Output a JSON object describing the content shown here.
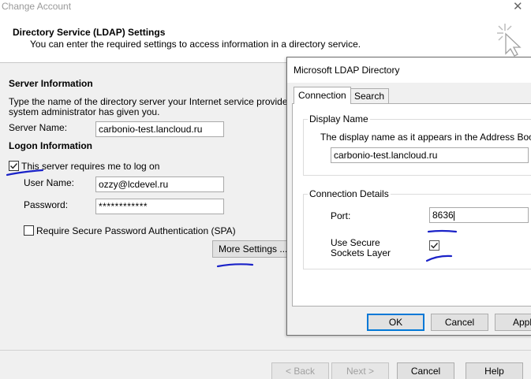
{
  "window": {
    "title": "Change Account",
    "close_glyph": "✕"
  },
  "header": {
    "title": "Directory Service (LDAP) Settings",
    "subtitle": "You can enter the required settings to access information in a directory service."
  },
  "server_info": {
    "section_label": "Server Information",
    "description_line1": "Type the name of the directory server your Internet service provider o",
    "description_line2": "system administrator has given you.",
    "server_name_label": "Server Name:",
    "server_name_value": "carbonio-test.lancloud.ru"
  },
  "logon_info": {
    "section_label": "Logon Information",
    "requires_logon_label": "This server requires me to log on",
    "requires_logon_checked": true,
    "user_name_label": "User Name:",
    "user_name_value": "ozzy@lcdevel.ru",
    "password_label": "Password:",
    "password_value": "************",
    "spa_label": "Require Secure Password Authentication (SPA)",
    "spa_checked": false
  },
  "more_settings_label": "More Settings ...",
  "footer": {
    "back_label": "< Back",
    "next_label": "Next >",
    "cancel_label": "Cancel",
    "help_label": "Help"
  },
  "ldap_dialog": {
    "title": "Microsoft LDAP Directory",
    "tabs": [
      {
        "label": "Connection",
        "active": true
      },
      {
        "label": "Search",
        "active": false
      }
    ],
    "display_name": {
      "group_label": "Display Name",
      "description": "The display name as it appears in the Address Book",
      "value": "carbonio-test.lancloud.ru"
    },
    "connection_details": {
      "group_label": "Connection Details",
      "port_label": "Port:",
      "port_value": "8636",
      "ssl_label_line1": "Use Secure",
      "ssl_label_line2": "Sockets Layer",
      "ssl_checked": true
    },
    "ok_label": "OK",
    "cancel_label": "Cancel",
    "apply_label": "Apply"
  },
  "colors": {
    "annotation_ink": "#1a22c8",
    "focus_border": "#0078d7"
  },
  "icons": {
    "header_icon": "cursor-sparkle-icon",
    "checkbox_check": "checkmark-icon"
  }
}
